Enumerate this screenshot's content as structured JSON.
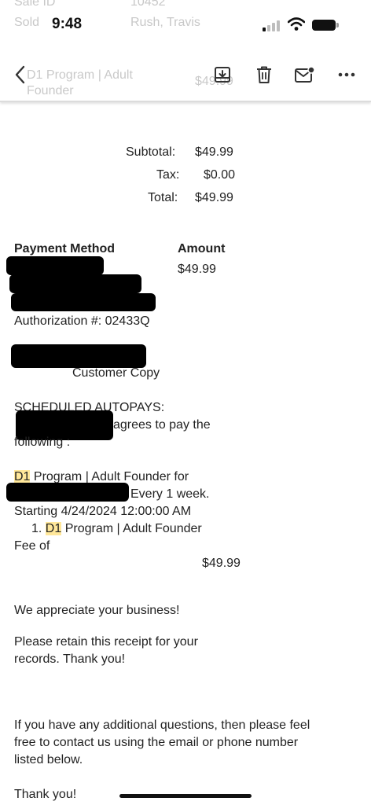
{
  "status_bar": {
    "time": "9:48",
    "ghost_header": [
      "Sale ID",
      "10452",
      "Sold",
      "Rush, Travis"
    ]
  },
  "toolbar": {
    "back_icon": "chevron-left-icon",
    "ghost_subject_line1": "D1 Program | Adult",
    "ghost_subject_line2": "Founder",
    "ghost_price": "$49.99",
    "actions": [
      "archive-icon",
      "trash-icon",
      "mark-unread-icon",
      "more-icon"
    ]
  },
  "totals": {
    "subtotal_label": "Subtotal:",
    "subtotal_value": "$49.99",
    "tax_label": "Tax:",
    "tax_value": "$0.00",
    "total_label": "Total:",
    "total_value": "$49.99"
  },
  "payment": {
    "method_header": "Payment Method",
    "amount_header": "Amount",
    "amount_value": "$49.99",
    "authorization": "Authorization #: 02433Q",
    "customer_copy": "Customer Copy"
  },
  "autopays": {
    "heading": "SCHEDULED AUTOPAYS:",
    "agrees": "agrees to pay the",
    "following": "following :",
    "program_hl": "D1",
    "program_rest": " Program | Adult Founder for",
    "every": "Every 1 week.",
    "starting": "Starting 4/24/2024 12:00:00 AM",
    "item_num": "1. ",
    "item_hl": "D1",
    "item_rest": " Program | Adult Founder",
    "fee_of": "Fee of",
    "fee_value": "$49.99"
  },
  "closing": {
    "appreciate": "We appreciate your business!",
    "retain_line1": "Please retain this receipt for your",
    "retain_line2": "records. Thank you!",
    "questions_line1": "If you have any additional questions, then please feel",
    "questions_line2": "free to contact us using the email or phone number",
    "questions_line3": "listed below.",
    "thanks": "Thank you!"
  }
}
